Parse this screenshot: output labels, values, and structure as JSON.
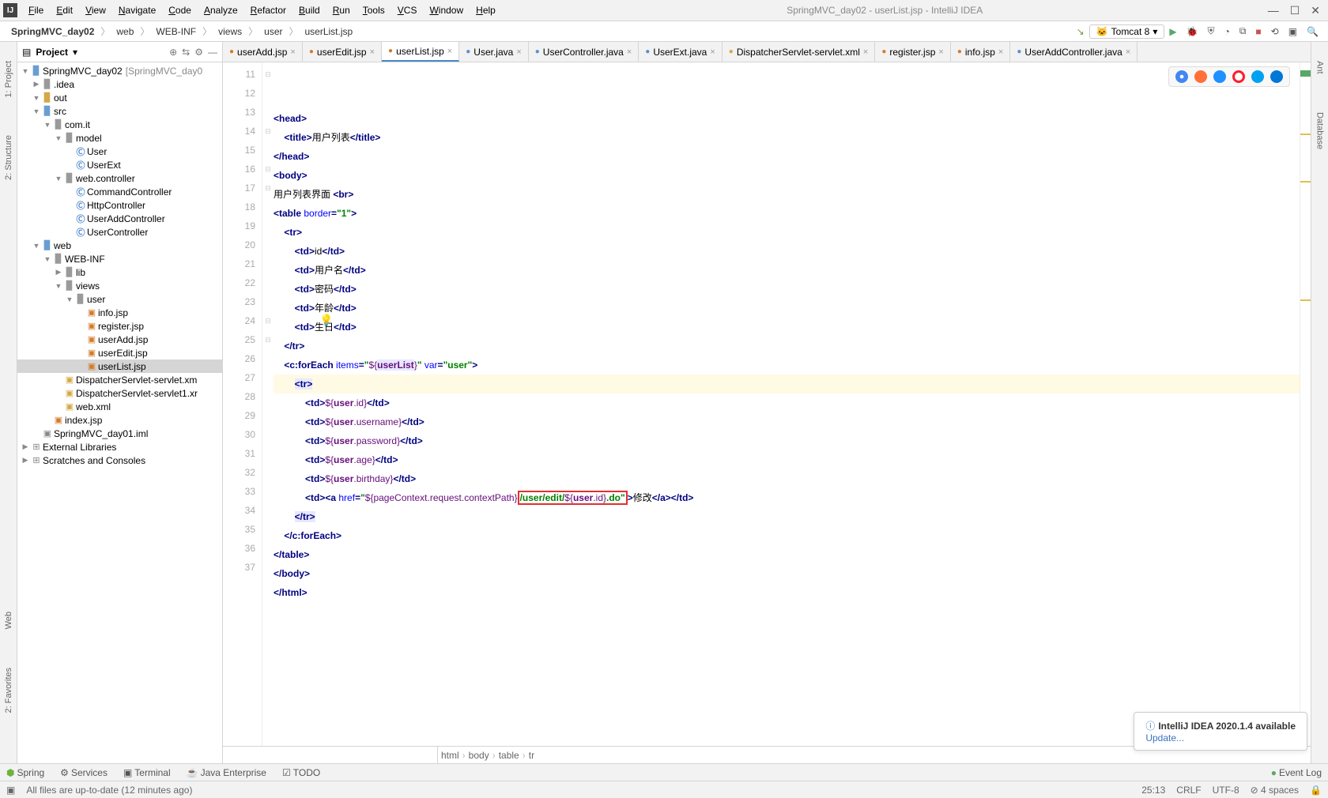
{
  "window": {
    "title": "SpringMVC_day02 - userList.jsp - IntelliJ IDEA"
  },
  "menu": [
    "File",
    "Edit",
    "View",
    "Navigate",
    "Code",
    "Analyze",
    "Refactor",
    "Build",
    "Run",
    "Tools",
    "VCS",
    "Window",
    "Help"
  ],
  "breadcrumbs": [
    "SpringMVC_day02",
    "web",
    "WEB-INF",
    "views",
    "user",
    "userList.jsp"
  ],
  "run_config": "Tomcat 8",
  "project_label": "Project",
  "tree": {
    "root": "SpringMVC_day02",
    "root_suffix": "[SpringMVC_day0",
    "idea": ".idea",
    "out": "out",
    "src": "src",
    "comit": "com.it",
    "model": "model",
    "user_class": "User",
    "userext_class": "UserExt",
    "webcontroller": "web.controller",
    "cmdctrl": "CommandController",
    "httpctrl": "HttpController",
    "useraddctrl": "UserAddController",
    "userctrl": "UserController",
    "web": "web",
    "webinf": "WEB-INF",
    "lib": "lib",
    "views": "views",
    "user_folder": "user",
    "infojsp": "info.jsp",
    "registerjsp": "register.jsp",
    "useraddjsp": "userAdd.jsp",
    "usereditjsp": "userEdit.jsp",
    "userlistjsp": "userList.jsp",
    "dispservlet": "DispatcherServlet-servlet.xm",
    "dispservlet1": "DispatcherServlet-servlet1.xr",
    "webxml": "web.xml",
    "indexjsp": "index.jsp",
    "iml": "SpringMVC_day01.iml",
    "extlibs": "External Libraries",
    "scratches": "Scratches and Consoles"
  },
  "tabs": [
    {
      "label": "userAdd.jsp",
      "icon": "jsp",
      "active": false
    },
    {
      "label": "userEdit.jsp",
      "icon": "jsp",
      "active": false
    },
    {
      "label": "userList.jsp",
      "icon": "jsp",
      "active": true
    },
    {
      "label": "User.java",
      "icon": "class",
      "active": false
    },
    {
      "label": "UserController.java",
      "icon": "class",
      "active": false
    },
    {
      "label": "UserExt.java",
      "icon": "class",
      "active": false
    },
    {
      "label": "DispatcherServlet-servlet.xml",
      "icon": "xml",
      "active": false
    },
    {
      "label": "register.jsp",
      "icon": "jsp",
      "active": false
    },
    {
      "label": "info.jsp",
      "icon": "jsp",
      "active": false
    },
    {
      "label": "UserAddController.java",
      "icon": "class",
      "active": false
    }
  ],
  "line_start": 11,
  "code_lines": [
    {
      "n": 11,
      "html": "<span class='tag'>&lt;head&gt;</span>"
    },
    {
      "n": 12,
      "html": "    <span class='tag'>&lt;title&gt;</span><span class='txt'>用户列表</span><span class='tag'>&lt;/title&gt;</span>"
    },
    {
      "n": 13,
      "html": "<span class='tag'>&lt;/head&gt;</span>"
    },
    {
      "n": 14,
      "html": "<span class='tag'>&lt;body&gt;</span>"
    },
    {
      "n": 15,
      "html": "<span class='txt'>用户列表界面 </span><span class='tag'>&lt;br&gt;</span>"
    },
    {
      "n": 16,
      "html": "<span class='tag'>&lt;table </span><span class='attr'>border</span><span class='tag'>=</span><span class='str'>\"1\"</span><span class='tag'>&gt;</span>"
    },
    {
      "n": 17,
      "html": "    <span class='tag'>&lt;tr&gt;</span>"
    },
    {
      "n": 18,
      "html": "        <span class='tag'>&lt;td&gt;</span><span class='txt'>id</span><span class='tag'>&lt;/td&gt;</span>"
    },
    {
      "n": 19,
      "html": "        <span class='tag'>&lt;td&gt;</span><span class='txt'>用户名</span><span class='tag'>&lt;/td&gt;</span>"
    },
    {
      "n": 20,
      "html": "        <span class='tag'>&lt;td&gt;</span><span class='txt'>密码</span><span class='tag'>&lt;/td&gt;</span>"
    },
    {
      "n": 21,
      "html": "        <span class='tag'>&lt;td&gt;</span><span class='txt'>年龄</span><span class='tag'>&lt;/td&gt;</span>"
    },
    {
      "n": 22,
      "html": "        <span class='tag'>&lt;td&gt;</span><span class='txt'>生日</span><span class='tag'>&lt;/td&gt;</span>"
    },
    {
      "n": 23,
      "html": "    <span class='tag'>&lt;/tr&gt;</span>"
    },
    {
      "n": 24,
      "html": "    <span class='tag'>&lt;c:forEach </span><span class='attr'>items</span><span class='tag'>=</span><span class='str'>\"</span><span class='var'>${</span><span class='varbold hlvar'>userList</span><span class='var'>}</span><span class='str'>\"</span> <span class='attr'>var</span><span class='tag'>=</span><span class='str'>\"user\"</span><span class='tag'>&gt;</span>"
    },
    {
      "n": 25,
      "hl": true,
      "html": "        <span class='hlvar'><span class='tag'>&lt;tr&gt;</span></span>"
    },
    {
      "n": 26,
      "html": "            <span class='tag'>&lt;td&gt;</span><span class='var'>${</span><span class='varbold'>user</span><span class='var'>.id}</span><span class='tag'>&lt;/td&gt;</span>"
    },
    {
      "n": 27,
      "html": "            <span class='tag'>&lt;td&gt;</span><span class='var'>${</span><span class='varbold'>user</span><span class='var'>.username}</span><span class='tag'>&lt;/td&gt;</span>"
    },
    {
      "n": 28,
      "html": "            <span class='tag'>&lt;td&gt;</span><span class='var'>${</span><span class='varbold'>user</span><span class='var'>.password}</span><span class='tag'>&lt;/td&gt;</span>"
    },
    {
      "n": 29,
      "html": "            <span class='tag'>&lt;td&gt;</span><span class='var'>${</span><span class='varbold'>user</span><span class='var'>.age}</span><span class='tag'>&lt;/td&gt;</span>"
    },
    {
      "n": 30,
      "html": "            <span class='tag'>&lt;td&gt;</span><span class='var'>${</span><span class='varbold'>user</span><span class='var'>.birthday}</span><span class='tag'>&lt;/td&gt;</span>"
    },
    {
      "n": 31,
      "html": "            <span class='tag'>&lt;td&gt;&lt;a </span><span class='attr'>href</span><span class='tag'>=</span><span class='str'>\"</span><span class='var'>${pageContext.request.contextPath}</span><span class='redbox'><span class='str'>/user/edit/</span><span class='var'>${</span><span class='varbold'>user</span><span class='var'>.id}</span><span class='str'>.do\"</span></span><span class='tag'>&gt;</span><span class='txt'>修改</span><span class='tag'>&lt;/a&gt;&lt;/td&gt;</span>"
    },
    {
      "n": 32,
      "html": "        <span class='hlvar'><span class='tag'>&lt;/tr&gt;</span></span>"
    },
    {
      "n": 33,
      "html": "    <span class='tag'>&lt;/c:forEach&gt;</span>"
    },
    {
      "n": 34,
      "html": "<span class='tag'>&lt;/table&gt;</span>"
    },
    {
      "n": 35,
      "html": "<span class='tag'>&lt;/body&gt;</span>"
    },
    {
      "n": 36,
      "html": "<span class='tag'>&lt;/html&gt;</span>"
    },
    {
      "n": 37,
      "html": " "
    }
  ],
  "editor_breadcrumbs": [
    "html",
    "body",
    "table",
    "tr"
  ],
  "notification": {
    "title": "IntelliJ IDEA 2020.1.4 available",
    "link": "Update..."
  },
  "toolwindows": {
    "spring": "Spring",
    "services": "Services",
    "terminal": "Terminal",
    "javaee": "Java Enterprise",
    "todo": "TODO",
    "eventlog": "Event Log"
  },
  "statusbar": {
    "msg": "All files are up-to-date (12 minutes ago)",
    "pos": "25:13",
    "crlf": "CRLF",
    "enc": "UTF-8",
    "indent": "4 spaces"
  },
  "left_tabs": [
    "1: Project",
    "2: Structure"
  ],
  "left_tabs2": [
    "2: Favorites",
    "Web"
  ],
  "right_tabs": [
    "Ant",
    "Database"
  ]
}
